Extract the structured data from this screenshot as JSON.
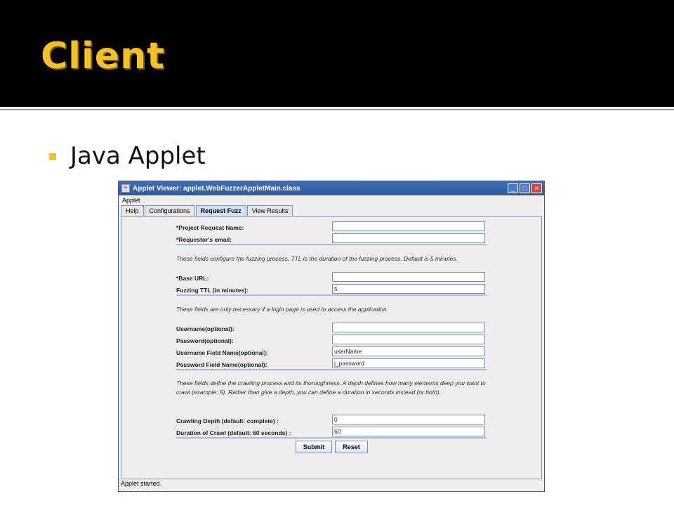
{
  "slide": {
    "title": "Client",
    "bullet": "Java Applet"
  },
  "window": {
    "title": "Applet Viewer: applet.WebFuzzerAppletMain.class",
    "menu": "Applet",
    "tabs": [
      "Help",
      "Configurations",
      "Request Fuzz",
      "View Results"
    ],
    "active_tab": "Request Fuzz",
    "status": "Applet started."
  },
  "form": {
    "project_request_name": {
      "label": "*Project Request Name:",
      "value": ""
    },
    "requestor_email": {
      "label": "*Requestor's email:",
      "value": ""
    },
    "note_fuzzing": "These fields configure the fuzzing process. TTL is the duration of the fuzzing process. Default is 5 minutes.",
    "base_url": {
      "label": "*Base URL:",
      "value": ""
    },
    "fuzzing_ttl": {
      "label": "Fuzzing TTL (in minutes):",
      "value": "5"
    },
    "note_login": "These fields are only necessary if a login page is used to access the application",
    "username": {
      "label": "Username(optional):",
      "value": ""
    },
    "password": {
      "label": "Password(optional):",
      "value": ""
    },
    "username_field": {
      "label": "Username Field Name(optional):",
      "value": "userName"
    },
    "password_field": {
      "label": "Password Field Name(optional):",
      "value": "j_password"
    },
    "note_crawl": "These fields define the crawling process and its thoroughness. A depth defines how many elements deep you want to crawl (example: 5). Rather than give a depth, you can define a duration in seconds instead (or both).",
    "crawling_depth": {
      "label": "Crawling Depth (default: complete) :",
      "value": "0"
    },
    "crawl_duration": {
      "label": "Duration of Crawl (default: 60 seconds) :",
      "value": "60"
    },
    "submit_label": "Submit",
    "reset_label": "Reset"
  },
  "colors": {
    "title_accent": "#f5c125",
    "window_title": "#2c5aa0"
  }
}
